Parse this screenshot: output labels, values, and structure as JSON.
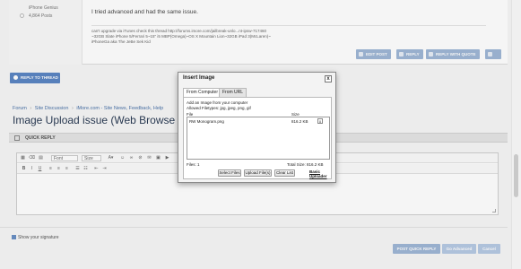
{
  "post": {
    "user_title": "iPhone Genius",
    "post_count": "4,864 Posts",
    "body": "I tried advanced and had the same issue.",
    "signature_lines": [
      "can't upgrade via iTunes check this thread http://forums.imore.com/jailbreak-unlo...nt-ipsw-717460",
      "~32GB Slate iPhone 5/Ferrari 5~15\" i5 MBP(Omega)~OS X Mountain Lion~32GB iPad 3(McLaren)~",
      "iPhoneGa aka The JeBe Sek Kid"
    ],
    "actions": {
      "edit": "EDIT POST",
      "reply": "REPLY",
      "reply_quote": "REPLY WITH QUOTE"
    }
  },
  "reply_to_thread": "REPLY TO THREAD",
  "breadcrumb": [
    "Forum",
    "Site Discussion",
    "iMore.com - Site News, Feedback, Help"
  ],
  "page_title": "Image Upload issue (Web Browse",
  "quick_reply": {
    "label": "QUICK REPLY",
    "toolbar": {
      "font": "Font",
      "size": "Size"
    },
    "show_signature": "Show your signature",
    "post_button": "POST QUICK REPLY",
    "advanced_button": "Go Advanced",
    "cancel_button": "Cancel"
  },
  "dialog": {
    "title": "Insert Image",
    "close": "x",
    "tabs": [
      "From Computer",
      "From URL"
    ],
    "help_line1": "Add an Image from your computer",
    "help_line2": "Allowed Filetypes: jpg, jpeg, png, gif",
    "col_file": "File",
    "col_size": "Size",
    "files": [
      {
        "name": "RW Monogram.png",
        "size": "816.2 KB",
        "remove": "x"
      }
    ],
    "files_count": "Files: 1",
    "total_size": "Total Size: 816.2 KB",
    "buttons": {
      "select": "Select Files",
      "upload": "Upload File(s)",
      "clear": "Clear List"
    },
    "basic_uploader": [
      "Basic",
      "Uploader"
    ]
  },
  "colors": {
    "accent": "#5b86c3",
    "muted_button": "#9fb7d6",
    "title": "#2b3c55",
    "link": "#4a72a8"
  }
}
